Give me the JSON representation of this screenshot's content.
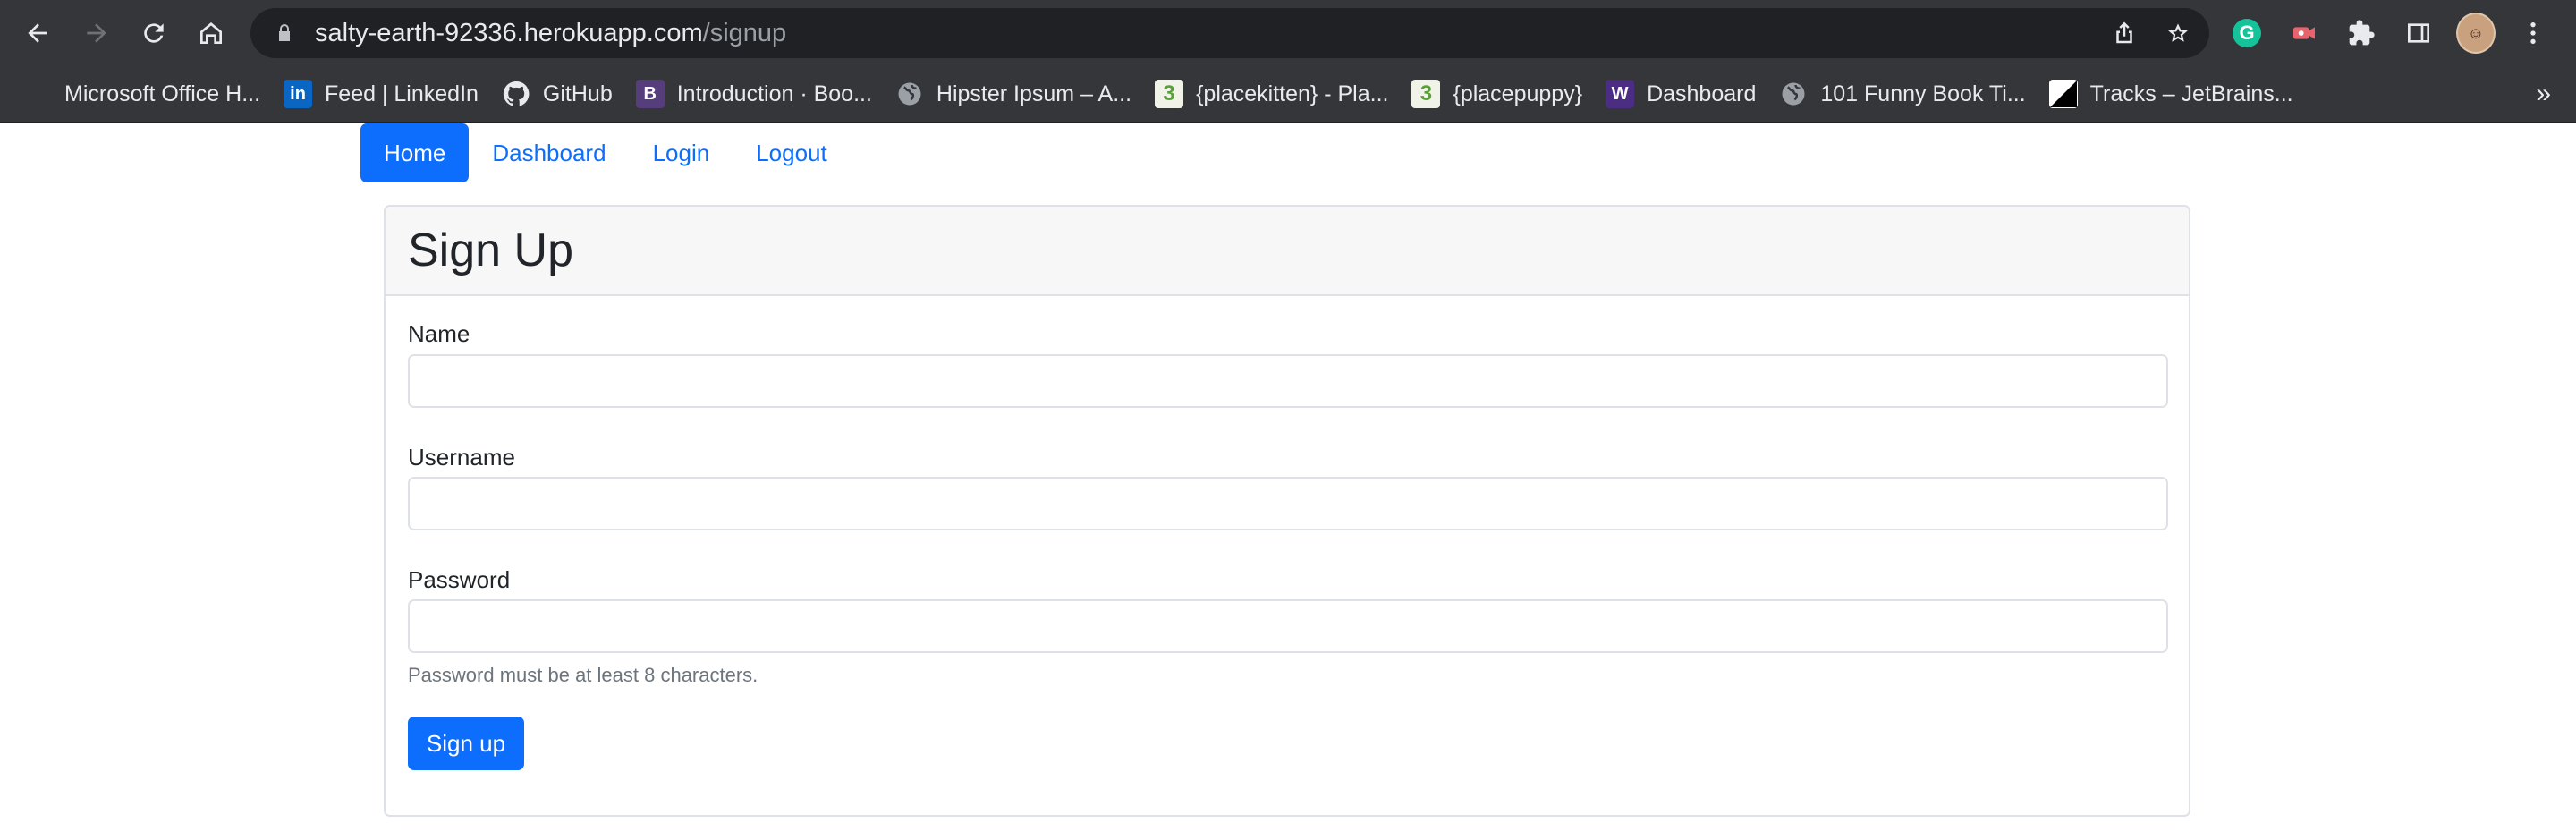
{
  "browser": {
    "url_host": "salty-earth-92336.herokuapp.com",
    "url_path": "/signup",
    "bookmarks": [
      {
        "label": "Microsoft Office H...",
        "icon": "microsoft-icon"
      },
      {
        "label": "Feed | LinkedIn",
        "icon": "linkedin-icon",
        "glyph": "in"
      },
      {
        "label": "GitHub",
        "icon": "github-icon"
      },
      {
        "label": "Introduction · Boo...",
        "icon": "bootstrap-icon",
        "glyph": "B"
      },
      {
        "label": "Hipster Ipsum – A...",
        "icon": "globe-icon"
      },
      {
        "label": "{placekitten} - Pla...",
        "icon": "placekitten-icon",
        "glyph": "3"
      },
      {
        "label": "{placepuppy}",
        "icon": "placepuppy-icon",
        "glyph": "3"
      },
      {
        "label": "Dashboard",
        "icon": "uw-icon",
        "glyph": "W"
      },
      {
        "label": "101 Funny Book Ti...",
        "icon": "globe-icon"
      },
      {
        "label": "Tracks – JetBrains...",
        "icon": "jetbrains-icon"
      }
    ],
    "more_bookmarks": "»",
    "grammarly_glyph": "G"
  },
  "nav": {
    "home": "Home",
    "dashboard": "Dashboard",
    "login": "Login",
    "logout": "Logout"
  },
  "form": {
    "title": "Sign Up",
    "name_label": "Name",
    "name_value": "",
    "username_label": "Username",
    "username_value": "",
    "password_label": "Password",
    "password_value": "",
    "password_help": "Password must be at least 8 characters.",
    "submit_label": "Sign up"
  },
  "colors": {
    "primary": "#0d6efd",
    "chrome_bg": "#35363a",
    "omnibox_bg": "#202124"
  }
}
